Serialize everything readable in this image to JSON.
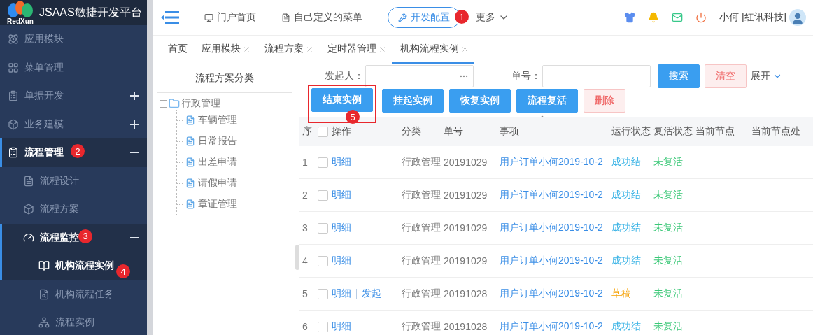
{
  "brand": {
    "logo_text": "RedXun",
    "title": "JSAAS敏捷开发平台"
  },
  "sidebar": {
    "items": [
      {
        "label": "应用模块",
        "expandable": false,
        "selected": false
      },
      {
        "label": "菜单管理",
        "expandable": false,
        "selected": false
      },
      {
        "label": "单据开发",
        "expandable": true,
        "expanded": false,
        "selected": false
      },
      {
        "label": "业务建模",
        "expandable": true,
        "expanded": false,
        "selected": false
      },
      {
        "label": "流程管理",
        "expandable": true,
        "expanded": true,
        "selected": true,
        "callout": "2",
        "children": [
          {
            "label": "流程设计",
            "expandable": false,
            "selected": false
          },
          {
            "label": "流程方案",
            "expandable": false,
            "selected": false
          },
          {
            "label": "流程监控",
            "expandable": true,
            "expanded": true,
            "selected": true,
            "callout": "3",
            "children": [
              {
                "label": "机构流程实例",
                "expandable": false,
                "selected": true,
                "callout": "4"
              },
              {
                "label": "机构流程任务",
                "expandable": false,
                "selected": false
              },
              {
                "label": "流程实例",
                "expandable": false,
                "selected": false
              }
            ]
          }
        ]
      }
    ]
  },
  "header": {
    "nav": [
      {
        "label": "门户首页",
        "selected": false
      },
      {
        "label": "自己定义的菜单",
        "selected": false
      },
      {
        "label": "开发配置",
        "selected": true,
        "callout": "1"
      }
    ],
    "more": "更多",
    "user": "小何 [红讯科技]"
  },
  "tabs": [
    {
      "label": "首页",
      "closable": false,
      "selected": false
    },
    {
      "label": "应用模块",
      "closable": true,
      "selected": false
    },
    {
      "label": "流程方案",
      "closable": true,
      "selected": false
    },
    {
      "label": "定时器管理",
      "closable": true,
      "selected": false
    },
    {
      "label": "机构流程实例",
      "closable": true,
      "selected": true
    }
  ],
  "tree": {
    "title": "流程方案分类",
    "nodes": [
      {
        "label": "行政管理",
        "expanded": true,
        "children": [
          {
            "label": "车辆管理"
          },
          {
            "label": "日常报告"
          },
          {
            "label": "出差申请"
          },
          {
            "label": "请假申请"
          },
          {
            "label": "章证管理"
          }
        ]
      }
    ]
  },
  "filters": [
    {
      "label": "发起人：",
      "kind": "picker"
    },
    {
      "label": "单号：",
      "kind": "text"
    }
  ],
  "filter_buttons": [
    {
      "label": "搜索",
      "kind": "primary"
    },
    {
      "label": "清空",
      "kind": "danger"
    }
  ],
  "expand_toggle": "展开",
  "actions": [
    {
      "label": "结束实例",
      "kind": "primary",
      "highlighted": true,
      "callout": "5"
    },
    {
      "label": "挂起实例",
      "kind": "primary",
      "highlighted": false
    },
    {
      "label": "恢复实例",
      "kind": "primary",
      "highlighted": false
    },
    {
      "label": "流程复活",
      "kind": "primary",
      "highlighted": false
    },
    {
      "label": "删除",
      "kind": "danger",
      "highlighted": false
    }
  ],
  "table": {
    "select_all_checked": false,
    "columns": [
      "序",
      "操作",
      "分类",
      "单号",
      "事项",
      "运行状态",
      "复活状态",
      "当前节点",
      "当前节点处"
    ],
    "rows": [
      {
        "index": "1",
        "checked": false,
        "actions": [
          "明细"
        ],
        "category": "行政管理",
        "number": "20191029",
        "subject": "用户订单小何2019-10-2",
        "run_status": {
          "text": "成功结",
          "color": "#3cb4e6"
        },
        "revive_status": "未复活"
      },
      {
        "index": "2",
        "checked": false,
        "actions": [
          "明细"
        ],
        "category": "行政管理",
        "number": "20191029",
        "subject": "用户订单小何2019-10-2",
        "run_status": {
          "text": "成功结",
          "color": "#3cb4e6"
        },
        "revive_status": "未复活"
      },
      {
        "index": "3",
        "checked": false,
        "actions": [
          "明细"
        ],
        "category": "行政管理",
        "number": "20191029",
        "subject": "用户订单小何2019-10-2",
        "run_status": {
          "text": "成功结",
          "color": "#3cb4e6"
        },
        "revive_status": "未复活"
      },
      {
        "index": "4",
        "checked": false,
        "actions": [
          "明细"
        ],
        "category": "行政管理",
        "number": "20191029",
        "subject": "用户订单小何2019-10-2",
        "run_status": {
          "text": "成功结",
          "color": "#3cb4e6"
        },
        "revive_status": "未复活"
      },
      {
        "index": "5",
        "checked": false,
        "actions": [
          "明细",
          "发起"
        ],
        "category": "行政管理",
        "number": "20191028",
        "subject": "用户订单小何2019-10-2",
        "run_status": {
          "text": "草稿",
          "color": "#f5a000"
        },
        "revive_status": "未复活"
      },
      {
        "index": "6",
        "checked": false,
        "actions": [
          "明细"
        ],
        "category": "行政管理",
        "number": "20191028",
        "subject": "用户订单小何2019-10-2",
        "run_status": {
          "text": "成功结",
          "color": "#3cb4e6"
        },
        "revive_status": "未复活"
      }
    ]
  }
}
